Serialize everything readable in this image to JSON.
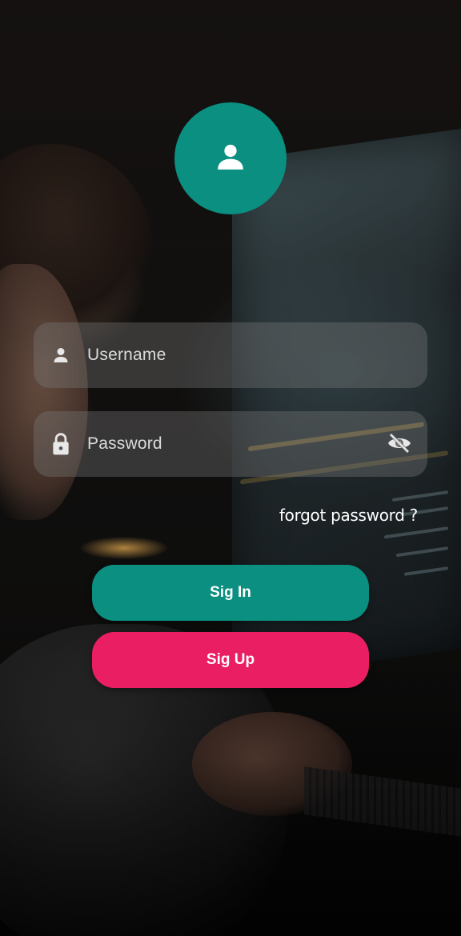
{
  "avatar": {
    "icon": "person-icon",
    "color": "#0a8f80"
  },
  "username_field": {
    "icon": "person-icon",
    "placeholder": "Username"
  },
  "password_field": {
    "icon": "lock-icon",
    "placeholder": "Password",
    "toggle_icon": "eye-off-icon"
  },
  "forgot_link": "forgot password ?",
  "buttons": {
    "sign_in": {
      "label": "Sig In",
      "color": "#0b8f81"
    },
    "sign_up": {
      "label": "Sig Up",
      "color": "#e91e63"
    }
  }
}
